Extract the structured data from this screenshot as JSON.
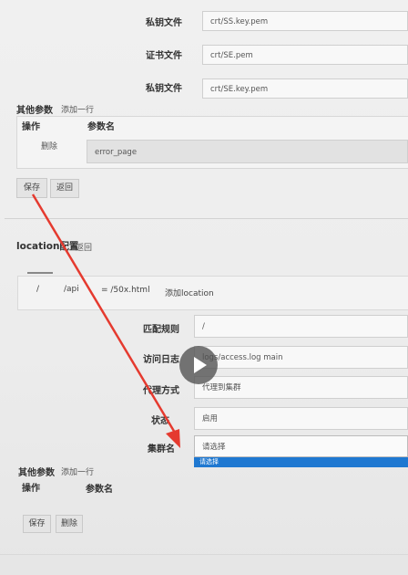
{
  "top_fields": [
    {
      "label": "私钥文件",
      "value": "crt/SS.key.pem"
    },
    {
      "label": "证书文件",
      "value": "crt/SE.pem"
    },
    {
      "label": "私钥文件",
      "value": "crt/SE.key.pem"
    }
  ],
  "other_params": {
    "title": "其他参数",
    "add_row": "添加一行",
    "col_action": "操作",
    "col_name": "参数名",
    "row_delete": "删除",
    "row_value": "error_page"
  },
  "top_buttons": {
    "save": "保存",
    "back": "返回"
  },
  "location": {
    "title": "location配置",
    "back": "返回",
    "tabs": [
      "/",
      "/api",
      "= /50x.html",
      "添加location"
    ]
  },
  "form": {
    "match_rule": {
      "label": "匹配规则",
      "value": "/"
    },
    "access_log": {
      "label": "访问日志",
      "value": "logs/access.log main"
    },
    "proxy_mode": {
      "label": "代理方式",
      "value": "代理到集群"
    },
    "enable": {
      "label": "状态",
      "value": "启用"
    },
    "cluster": {
      "label": "集群名",
      "placeholder": "请选择",
      "option": "请选择"
    }
  },
  "other_params_2": {
    "title": "其他参数",
    "add_row": "添加一行",
    "col_action": "操作",
    "col_name": "参数名"
  },
  "bottom_buttons": {
    "save": "保存",
    "delete": "删除"
  },
  "colors": {
    "accent_blue": "#1f78d1",
    "arrow_red": "#e53a2f"
  }
}
